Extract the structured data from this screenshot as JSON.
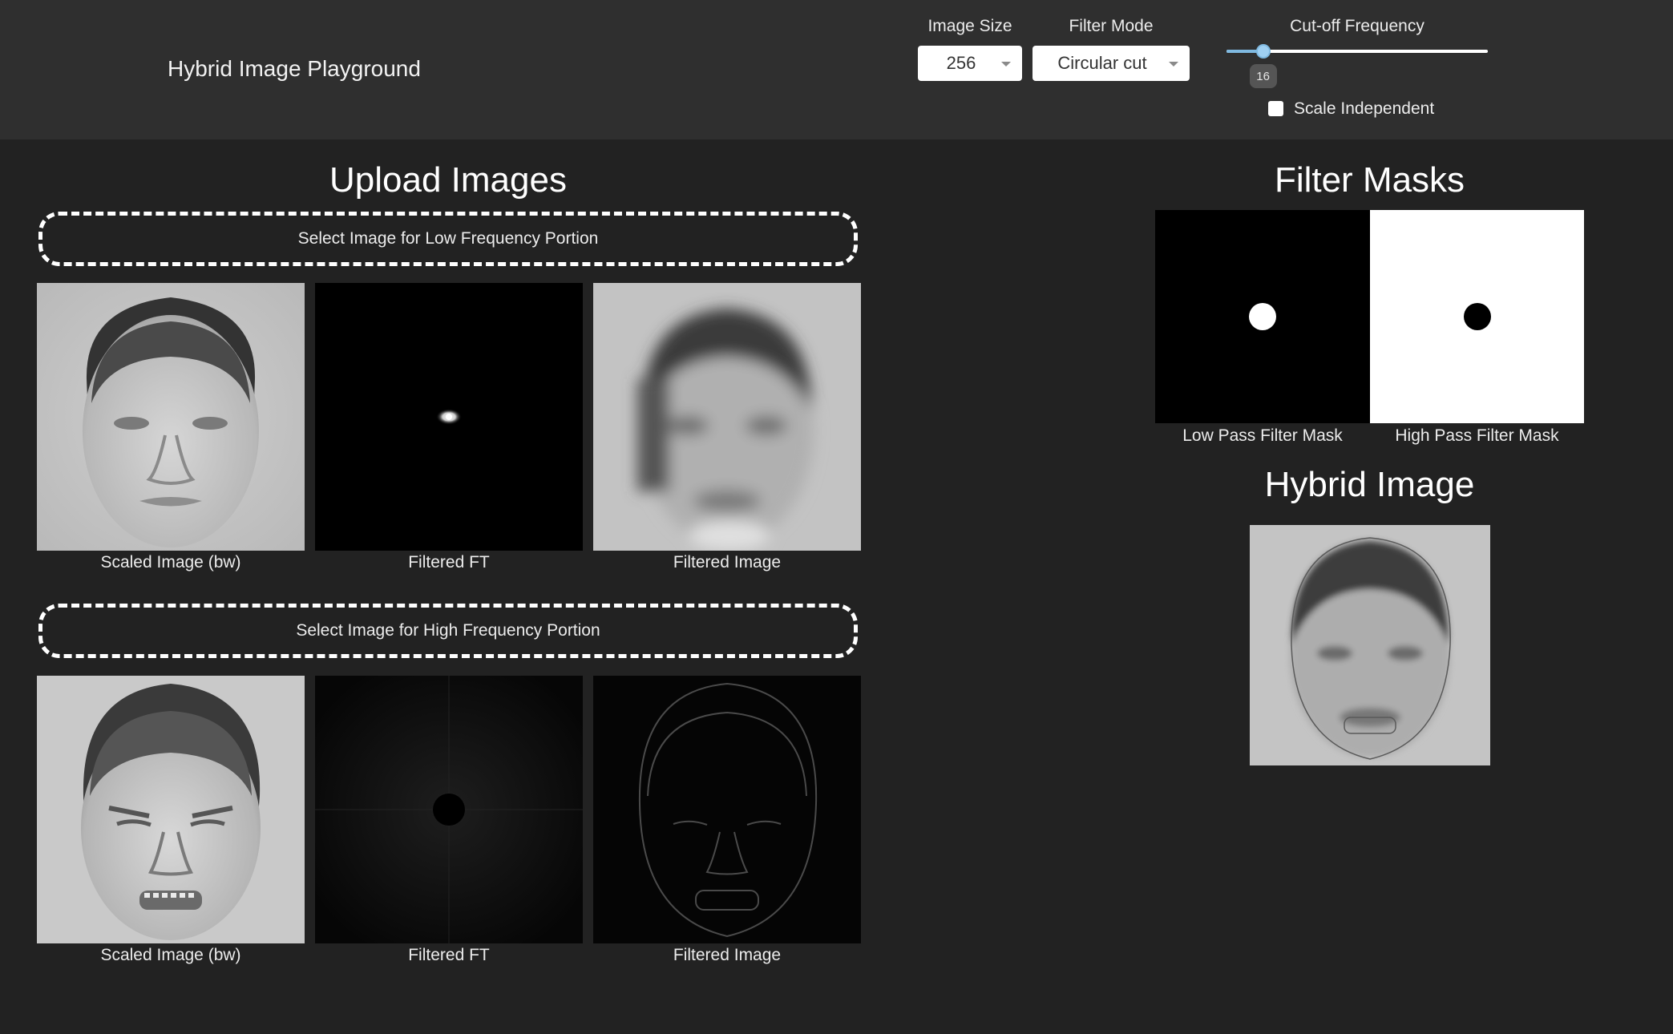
{
  "header": {
    "title": "Hybrid Image Playground",
    "image_size": {
      "label": "Image Size",
      "value": "256"
    },
    "filter_mode": {
      "label": "Filter Mode",
      "value": "Circular cut"
    },
    "cutoff": {
      "label": "Cut-off Frequency",
      "value": "16",
      "fraction": 0.14
    },
    "scale_independent": {
      "label": "Scale Independent",
      "checked": false
    }
  },
  "upload": {
    "title": "Upload Images",
    "low": {
      "dropzone": "Select Image for Low Frequency Portion",
      "captions": [
        "Scaled Image (bw)",
        "Filtered FT",
        "Filtered Image"
      ]
    },
    "high": {
      "dropzone": "Select Image for High Frequency Portion",
      "captions": [
        "Scaled Image (bw)",
        "Filtered FT",
        "Filtered Image"
      ]
    }
  },
  "masks": {
    "title": "Filter Masks",
    "low_label": "Low Pass Filter Mask",
    "high_label": "High Pass Filter Mask"
  },
  "hybrid": {
    "title": "Hybrid Image"
  }
}
